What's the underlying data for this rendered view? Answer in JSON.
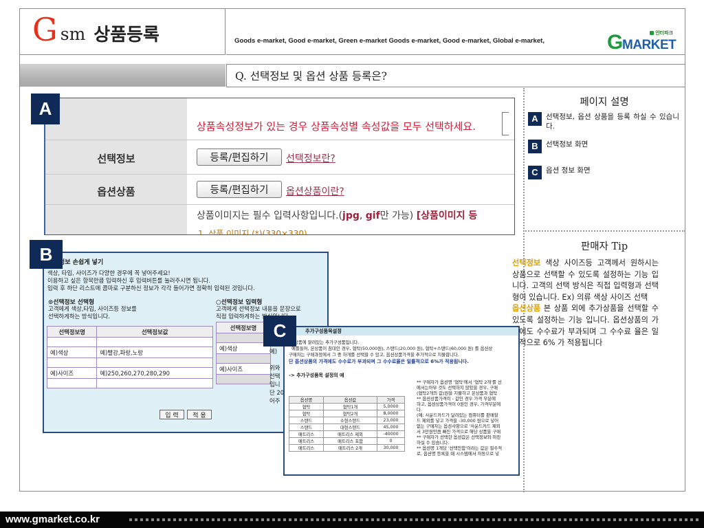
{
  "header": {
    "logo_g": "G",
    "logo_sm": "sm",
    "title": "상품등록",
    "slogan": "Goods e-market, Good e-market, Green e-market Goods e-market, Good e-market, Global e-market,",
    "gmarket_badge": "인터파크",
    "gmarket_g": "G",
    "gmarket_word": "MARKET"
  },
  "question": "Q. 선택정보 및 옵션 상품 등록은?",
  "sidebar": {
    "page_desc_title": "페이지 설명",
    "items": [
      {
        "label": "A",
        "text": "선택정보, 옵션 상품을 등록 하실 수 있습니다."
      },
      {
        "label": "B",
        "text": "선택정보 화면"
      },
      {
        "label": "C",
        "text": "옵션 정보 화면"
      }
    ],
    "tip_title": "판매자 Tip",
    "tip1_hl": "선택정보",
    "tip1": " 색상 사이즈등 고객께서 원하시는 상품으로 선택할 수 있도록 설정하는 기능 입니다. 고객의 선택 방식은 직접 입력형과 선택형이 있습니다. Ex) 의류 색상 사이즈 선택",
    "tip2_hl": "옵션상품",
    "tip2": " 본 상품 외에 추가상품을 선택할 수 있도록 설정하는 기능 입니다. 옵션상품의 가격에도 수수료가 부과되며 그 수수료 율은 일률적으로 6% 가 적용됩니다"
  },
  "panel_a": {
    "badge": "A",
    "notice": "상품속성정보가 있는 경우 상품속성별 속성값을 모두 선택하세요.",
    "row1_label": "선택정보",
    "row1_button": "등록/편집하기",
    "row1_link": "선택정보란?",
    "row2_label": "옵션상품",
    "row2_button": "등록/편집하기",
    "row2_link": "옵션상품이란?",
    "image_note": "상품이미지는 필수 입력사항입니다.(",
    "image_fmt1": "jpg",
    "image_sep": ", ",
    "image_fmt2": "gif",
    "image_tail": "만 가능) ",
    "image_bold": "[상품이미지 등",
    "image_row": "1. 상품 이미지 (*)(330×330)"
  },
  "panel_b": {
    "badge": "B",
    "title": "정보 손쉽게 넣기",
    "lines": [
      "색상, 타입, 사이즈가 다양한 경우에 꼭 넣어주세요!",
      "이용하고 싶은 항목만큼 입력하신 후 입력버튼를 눌러주시면 됩니다.",
      "입력 후 하단 리스트에 콤마로 구분하신 정보가 각각 들어가면 정확히 입력된 것입니다."
    ],
    "opt1": "⊙선택정보 선택형",
    "opt1_desc1": "고객에게 색상,타입, 사이즈등 정보를",
    "opt1_desc2": "선택하게하는 방식입니다.",
    "opt2": "○선택정보 입력형",
    "opt2_desc1": "고객에게 선택정보 내용을 문장으로",
    "opt2_desc2": "직접 입력하게하는 방식입니다.",
    "col1": "선택정보명",
    "col2": "선택정보값",
    "rows": [
      {
        "name": "예)색상",
        "value": "예)빨강,파랑,노랑"
      },
      {
        "name": "예)사이즈",
        "value": "예)250,260,270,280,290"
      }
    ],
    "col3": "선택정보명",
    "r_rows": [
      "예)색상",
      "예)사이즈"
    ],
    "right_lines": [
      "예)",
      "위와",
      "선택",
      "입니",
      "단 20",
      "어주"
    ],
    "btn_input": "입 력",
    "btn_apply": "적 용"
  },
  "panel_c": {
    "badge": "C",
    "header": "추가구성품목설정",
    "lines": [
      "상품에 딸려있는 추가구성품입니다.",
      "예를들어, 본상품이 침대인 경우, 협탁(50,000원), 스탠드(20,000 원), 협탁+스탠드(60,000 원) 를 옵션상",
      "구매자는 구매과정에서 그 중 하개를 선택할 수 있고, 옵션상품가격을 추가적으로 지불합니다."
    ],
    "blue_line": "단 옵션상품의 가격에도 수수료가 부과되며 그 수수료율은 일률적으로 6%가 적용됩니다.",
    "example_title": "-> 추가구성품목 설정의 예",
    "table_head": [
      "옵션명",
      "옵션값",
      "가격"
    ],
    "table_rows": [
      [
        "협탁",
        "협탁1개",
        "5,0000"
      ],
      [
        "협탁",
        "협탁2개",
        "8,0000"
      ],
      [
        "스탠드",
        "소형스탠드",
        "23,000"
      ],
      [
        "스탠드",
        "대형스탠드",
        "45,000"
      ],
      [
        "매트리스",
        "매트리스 제외",
        "-40000"
      ],
      [
        "매트리스",
        "매트리스 포함",
        "0"
      ],
      [
        "매트리스",
        "매트리스 2개",
        "30,000"
      ]
    ],
    "right_lines": [
      "** 구매자가 옵션명 '협탁'에서 '협탁 2개'를 선",
      "에서는아무 것도 선택하지 않았을 경우, 구매",
      "(협탁2개의 값)원을 지불하고 본상품과 협탁",
      "** 옵션상품가격이 - 값인 경우 가격 부분에",
      "하고, 옵션상품가격이 0원인 경우, 가격부분에",
      "다.",
      "(예: 사운드카드가 달려있는 컴퓨터를 판매할",
      "드 제외를 넣고 가격을 -30,000 원으로 넣어",
      "없는 구매자는 옵션사항으로 '사운드카드 제외",
      "서 3만원만큼 빠진 가격으로 해당 상품을 구매",
      "** 구매자가 선택한 옵션값은 선택정보와 마찬",
      "하실 수 있습니다.",
      "** 옵션명 1개당 '선택안함'이라는 값은 필수적",
      "로, 옵션명 등록을 때 시스템에서 자동으로 넣"
    ]
  },
  "footer": {
    "url": "www.gmarket.co.kr"
  }
}
